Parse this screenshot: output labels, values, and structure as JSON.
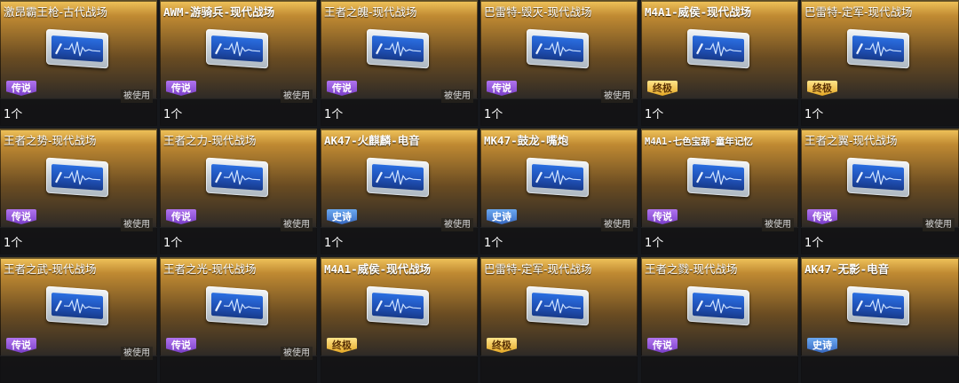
{
  "rarity_labels": {
    "legend": "传说",
    "epic": "史诗",
    "ultimate": "终极"
  },
  "used_label": "被使用",
  "colors": {
    "card_gold": "#f0c35a",
    "legend_purple": "#7a3ec8",
    "epic_blue": "#3768c0",
    "ultimate_gold": "#e4a826"
  },
  "items": [
    {
      "name": "激昂霸王枪-古代战场",
      "rarity": "legend",
      "used": true,
      "count": "1个"
    },
    {
      "name": "AWM-游骑兵-现代战场",
      "rarity": "legend",
      "used": true,
      "count": "1个"
    },
    {
      "name": "王者之魄-现代战场",
      "rarity": "legend",
      "used": true,
      "count": "1个"
    },
    {
      "name": "巴雷特-毁灭-现代战场",
      "rarity": "legend",
      "used": true,
      "count": "1个"
    },
    {
      "name": "M4A1-威侯-现代战场",
      "rarity": "ultimate",
      "used": false,
      "count": "1个"
    },
    {
      "name": "巴雷特-定军-现代战场",
      "rarity": "ultimate",
      "used": false,
      "count": "1个"
    },
    {
      "name": "王者之势-现代战场",
      "rarity": "legend",
      "used": true,
      "count": "1个"
    },
    {
      "name": "王者之力-现代战场",
      "rarity": "legend",
      "used": true,
      "count": "1个"
    },
    {
      "name": "AK47-火麒麟-电音",
      "rarity": "epic",
      "used": true,
      "count": "1个"
    },
    {
      "name": "MK47-鼓龙-嘴炮",
      "rarity": "epic",
      "used": true,
      "count": "1个"
    },
    {
      "name": "M4A1-七色宝葫-童年记忆",
      "rarity": "legend",
      "used": true,
      "count": "1个"
    },
    {
      "name": "王者之翼-现代战场",
      "rarity": "legend",
      "used": true,
      "count": "1个"
    },
    {
      "name": "王者之武-现代战场",
      "rarity": "legend",
      "used": true,
      "count": ""
    },
    {
      "name": "王者之光-现代战场",
      "rarity": "legend",
      "used": true,
      "count": ""
    },
    {
      "name": "M4A1-威侯-现代战场",
      "rarity": "ultimate",
      "used": false,
      "count": ""
    },
    {
      "name": "巴雷特-定军-现代战场",
      "rarity": "ultimate",
      "used": false,
      "count": ""
    },
    {
      "name": "王者之戮-现代战场",
      "rarity": "legend",
      "used": false,
      "count": ""
    },
    {
      "name": "AK47-无影-电音",
      "rarity": "epic",
      "used": false,
      "count": ""
    }
  ]
}
